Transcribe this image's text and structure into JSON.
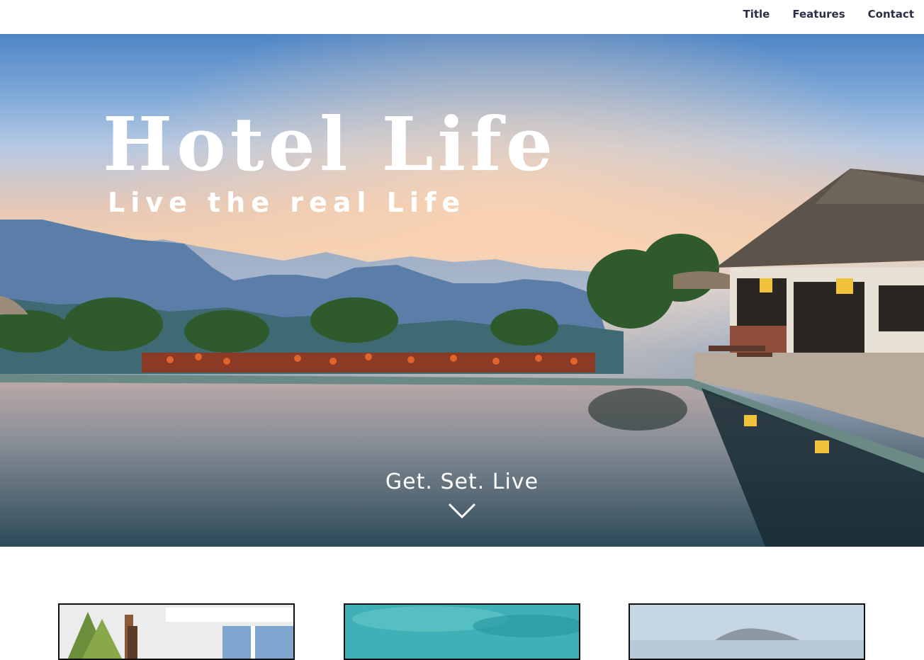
{
  "nav": {
    "items": [
      "Title",
      "Features",
      "Contact"
    ]
  },
  "hero": {
    "title": "Hotel Life",
    "subtitle": "Live the real Life",
    "tagline": "Get. Set. Live",
    "scroll_icon": "chevron-down-icon"
  },
  "colors": {
    "nav_text": "#2b2f45",
    "hero_text": "#ffffff",
    "card_border": "#111111"
  }
}
